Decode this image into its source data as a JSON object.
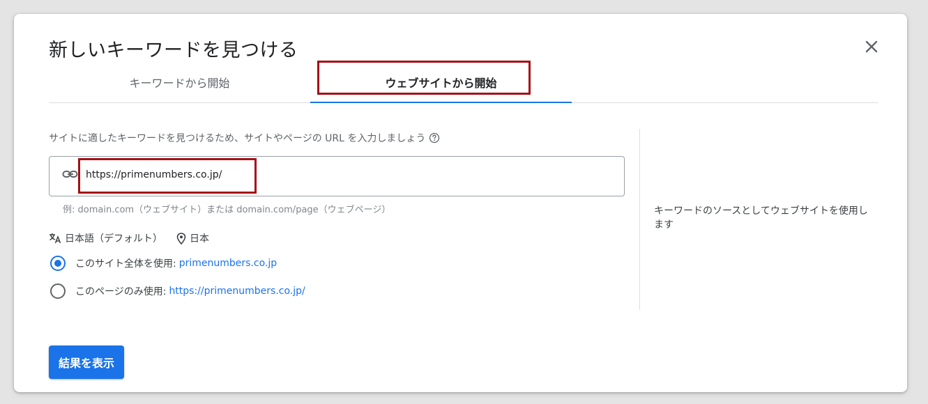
{
  "dialog": {
    "title": "新しいキーワードを見つける",
    "close_icon": "close-icon"
  },
  "tabs": [
    {
      "label": "キーワードから開始",
      "active": false
    },
    {
      "label": "ウェブサイトから開始",
      "active": true
    }
  ],
  "form": {
    "prompt": "サイトに適したキーワードを見つけるため、サイトやページの URL を入力しましょう",
    "help_icon": "help-circle-icon",
    "url_value": "https://primenumbers.co.jp/",
    "link_icon": "link-icon",
    "example": "例: domain.com（ウェブサイト）または domain.com/page（ウェブページ）",
    "language": "日本語（デフォルト）",
    "language_icon": "translate-icon",
    "location": "日本",
    "location_icon": "location-pin-icon",
    "options": [
      {
        "label": "このサイト全体を使用:",
        "value": "primenumbers.co.jp",
        "selected": true
      },
      {
        "label": "このページのみ使用:",
        "value": "https://primenumbers.co.jp/",
        "selected": false
      }
    ]
  },
  "side_panel": {
    "description": "キーワードのソースとしてウェブサイトを使用します"
  },
  "actions": {
    "submit_label": "結果を表示"
  },
  "colors": {
    "accent": "#1a73e8",
    "highlight_box": "#a50f15"
  }
}
